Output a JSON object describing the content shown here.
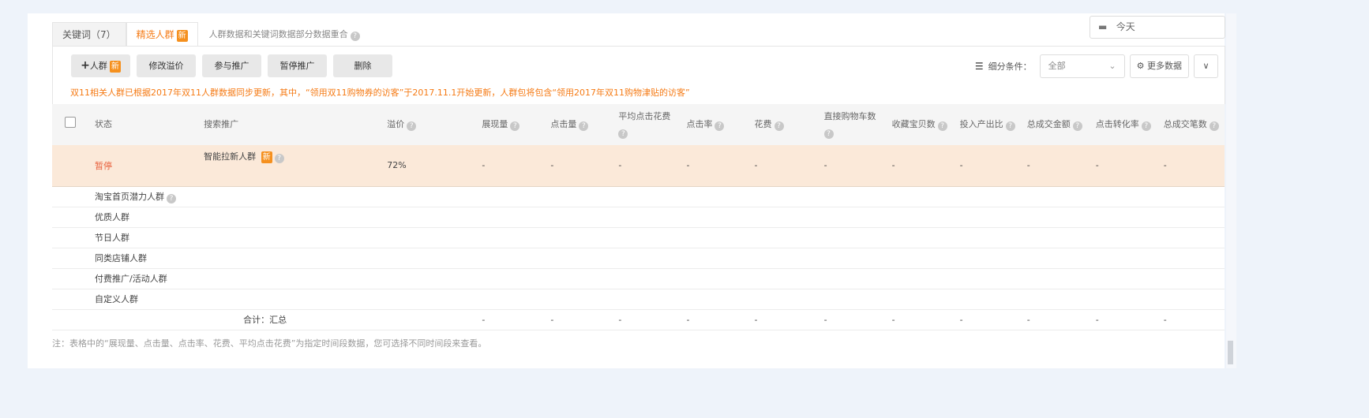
{
  "tabs": [
    {
      "label": "关键词（7）"
    },
    {
      "label": "精选人群",
      "badge": "新"
    }
  ],
  "tab_note": "人群数据和关键词数据部分数据重合",
  "date": {
    "icon": "calendar-icon",
    "value": "今天"
  },
  "toolbar": {
    "add_label": "人群",
    "add_badge": "新",
    "buttons": [
      "修改溢价",
      "参与推广",
      "暂停推广",
      "删除"
    ]
  },
  "filter": {
    "label": "细分条件：",
    "selected": "全部",
    "more_label": "更多数据"
  },
  "warning": "双11相关人群已根据2017年双11人群数据同步更新，其中，“领用双11购物券的访客”于2017.11.1开始更新，人群包将包含“领用2017年双11购物津贴的访客”",
  "columns": [
    "状态",
    "搜索推广",
    "溢价",
    "展现量",
    "点击量",
    "平均点击花费",
    "点击率",
    "花费",
    "直接购物车数",
    "收藏宝贝数",
    "投入产出比",
    "总成交金额",
    "点击转化率",
    "总成交笔数"
  ],
  "highlight_row": {
    "status": "暂停",
    "name": "智能拉新人群",
    "badge": "新",
    "premium": "72%",
    "values": [
      "-",
      "-",
      "-",
      "-",
      "-",
      "-",
      "-",
      "-",
      "-",
      "-",
      "-"
    ]
  },
  "groups": [
    "淘宝首页潜力人群",
    "优质人群",
    "节日人群",
    "同类店铺人群",
    "付费推广/活动人群",
    "自定义人群"
  ],
  "total": {
    "label": "合计：汇总",
    "values": [
      "-",
      "-",
      "-",
      "-",
      "-",
      "-",
      "-",
      "-",
      "-",
      "-",
      "-"
    ]
  },
  "note": "注：表格中的“展现量、点击量、点击率、花费、平均点击花费”为指定时间段数据，您可选择不同时间段来查看。",
  "colors": {
    "accent": "#f57b16",
    "highlight": "#fbe9d9",
    "paused": "#e8603c"
  }
}
